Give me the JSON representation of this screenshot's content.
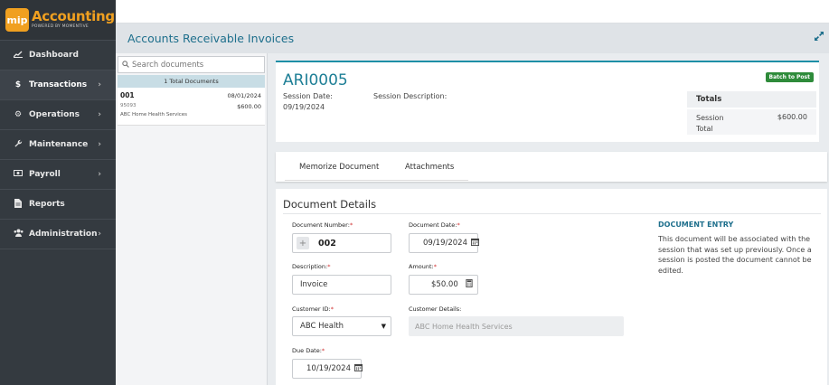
{
  "app": {
    "logo_mark": "mip",
    "logo_title": "Accounting",
    "logo_subtitle": "POWERED BY MOMENTIVE"
  },
  "sidebar": {
    "items": [
      {
        "label": "Dashboard",
        "icon": "chart-line-icon",
        "glyph": "⛶",
        "has_chevron": false
      },
      {
        "label": "Transactions",
        "icon": "dollar-icon",
        "glyph": "$",
        "has_chevron": true,
        "active": true
      },
      {
        "label": "Operations",
        "icon": "cogs-icon",
        "glyph": "⚙",
        "has_chevron": true
      },
      {
        "label": "Maintenance",
        "icon": "wrench-icon",
        "glyph": "🔧",
        "has_chevron": true
      },
      {
        "label": "Payroll",
        "icon": "money-icon",
        "glyph": "▣",
        "has_chevron": true
      },
      {
        "label": "Reports",
        "icon": "file-icon",
        "glyph": "▤",
        "has_chevron": false
      },
      {
        "label": "Administration",
        "icon": "users-icon",
        "glyph": "👥",
        "has_chevron": true
      }
    ]
  },
  "header": {
    "title": "Accounts Receivable Invoices"
  },
  "list": {
    "search_placeholder": "Search documents",
    "count_label": "1 Total Documents",
    "items": [
      {
        "number": "001",
        "date": "08/01/2024",
        "code": "95093",
        "amount": "$600.00",
        "customer": "ABC Home Health Services"
      }
    ]
  },
  "session": {
    "id": "ARI0005",
    "date_label": "Session Date:",
    "date_value": "09/19/2024",
    "description_label": "Session Description:",
    "batch_button": "Batch to Post",
    "totals_title": "Totals",
    "totals_label": "Session Total",
    "totals_value": "$600.00"
  },
  "tabs": [
    {
      "label": "Memorize Document"
    },
    {
      "label": "Attachments"
    }
  ],
  "details": {
    "title": "Document Details",
    "doc_number_label": "Document Number:",
    "doc_number_value": "002",
    "doc_date_label": "Document Date:",
    "doc_date_value": "09/19/2024",
    "description_label": "Description:",
    "description_value": "Invoice",
    "amount_label": "Amount:",
    "amount_value": "$50.00",
    "customer_id_label": "Customer ID:",
    "customer_id_value": "ABC Health",
    "customer_details_label": "Customer Details:",
    "customer_details_value": "ABC Home Health Services",
    "due_date_label": "Due Date:",
    "due_date_value": "10/19/2024",
    "required_mark": "*"
  },
  "entry": {
    "title": "DOCUMENT ENTRY",
    "text": "This document will be associated with the session that was set up previously. Once a session is posted the document cannot be edited."
  },
  "colors": {
    "accent": "#1e6f8c",
    "sidebar_bg": "#343a40",
    "brand": "#f0a020",
    "batch_button": "#2e8b3a",
    "required": "#d03030"
  }
}
